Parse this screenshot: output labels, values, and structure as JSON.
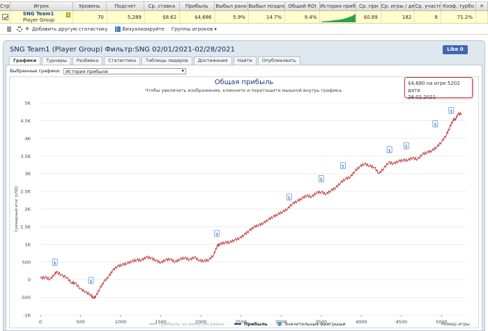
{
  "stats": {
    "headers": [
      "Стр.",
      "Игрок",
      "Уровень",
      "Подсчет",
      "Ср. ставка",
      "Прибыль",
      "Выбыл рано",
      "Выбыл поздно",
      "Общий ROI",
      "История прибыли",
      "Ср. при",
      "Ср. игры / день",
      "Ср. участни",
      "Коэф. турбо"
    ],
    "row": {
      "player_name": "SNG Team1",
      "player_group": "Player Group",
      "level": "70",
      "count": "5,289",
      "avg_stake": "$8.62",
      "profit": "$4,686",
      "early": "5.9%",
      "late": "14.7%",
      "roi": "9.4%",
      "avg_profit": "$0.89",
      "games_per_day": "182",
      "avg_participants": "9",
      "turbo": "71.2%"
    },
    "toolbar": {
      "add_stat": "Добавить другую статистику",
      "visualize": "Визуализируйте",
      "groups": "Группы игроков ▾"
    }
  },
  "panel": {
    "title": "SNG Team1 (Player Group) Фильтр:SNG 02/01/2021-02/28/2021",
    "like": "Like 0",
    "tabs": [
      "Графики",
      "Турниры",
      "Разбивка",
      "Статистика",
      "Таблицы лидеров",
      "Достижения",
      "Найти",
      "Опубликовать"
    ],
    "active_tab": 0,
    "select_label": "Выбранные графики:",
    "select_value": "История прибыли"
  },
  "tooltip": {
    "line1": "$4,680 на игре 5202 дата",
    "line2": "28.02.2021"
  },
  "legend": {
    "item1": "Прибыль за минусом рейка",
    "item2": "Прибыль",
    "item3": "Значительные выигрыши"
  },
  "colors": {
    "profit_line": "#c0393b",
    "rake_line": "#c8c8c8",
    "bigwin_marker": "#5b93d6",
    "sparkline": "#2e9e4f"
  },
  "chart_data": {
    "type": "line",
    "title": "Общая прибыль",
    "subtitle": "Чтобы увеличить изображение, кликните и перетащите мышкой внутрь графика.",
    "ylabel": "Суммарный итог (USD)",
    "xlabel": "Номер игры",
    "xlim": [
      0,
      5300
    ],
    "ylim": [
      -1000,
      5000
    ],
    "x_ticks": [
      "0",
      "500",
      "1000",
      "1500",
      "2000",
      "2500",
      "3000",
      "3500",
      "4000",
      "4500",
      "5000"
    ],
    "y_ticks": [
      "-1K",
      "-500",
      "0",
      "500",
      "1K",
      "1.5K",
      "2K",
      "2.5K",
      "3K",
      "3.5K",
      "4K",
      "4.5K",
      "5K"
    ],
    "grid": true,
    "legend_position": "bottom",
    "series": [
      {
        "name": "Прибыль",
        "x": [
          0,
          60,
          120,
          180,
          200,
          260,
          330,
          390,
          430,
          500,
          560,
          620,
          660,
          690,
          740,
          790,
          850,
          900,
          960,
          1020,
          1080,
          1140,
          1200,
          1260,
          1320,
          1380,
          1440,
          1500,
          1560,
          1620,
          1680,
          1740,
          1800,
          1860,
          1920,
          1980,
          2040,
          2100,
          2160,
          2200,
          2240,
          2300,
          2360,
          2420,
          2480,
          2540,
          2600,
          2660,
          2720,
          2780,
          2840,
          2900,
          2960,
          3020,
          3080,
          3140,
          3200,
          3260,
          3320,
          3380,
          3440,
          3500,
          3560,
          3620,
          3680,
          3740,
          3800,
          3860,
          3920,
          3980,
          4040,
          4100,
          4160,
          4220,
          4280,
          4340,
          4400,
          4460,
          4520,
          4580,
          4640,
          4700,
          4760,
          4820,
          4880,
          4940,
          5000,
          5060,
          5100,
          5140,
          5180,
          5202,
          5250
        ],
        "y": [
          40,
          70,
          10,
          160,
          220,
          130,
          60,
          -100,
          -90,
          -260,
          -350,
          -420,
          -520,
          -470,
          -250,
          -60,
          90,
          260,
          380,
          420,
          460,
          520,
          560,
          550,
          640,
          610,
          540,
          480,
          560,
          580,
          500,
          580,
          620,
          560,
          640,
          540,
          530,
          560,
          700,
          950,
          1010,
          1050,
          1060,
          1120,
          1170,
          1270,
          1380,
          1490,
          1540,
          1600,
          1700,
          1780,
          1850,
          1920,
          2000,
          2150,
          2220,
          2300,
          2380,
          2340,
          2460,
          2480,
          2420,
          2520,
          2600,
          2740,
          2850,
          2900,
          3070,
          3200,
          3280,
          3220,
          3180,
          3000,
          3150,
          3320,
          3280,
          3350,
          3380,
          3380,
          3450,
          3400,
          3550,
          3600,
          3650,
          3750,
          3900,
          4100,
          4300,
          4500,
          4560,
          4680,
          4700
        ]
      }
    ],
    "big_wins": [
      {
        "x": 180,
        "y": 290
      },
      {
        "x": 630,
        "y": -230
      },
      {
        "x": 2200,
        "y": 1100
      },
      {
        "x": 3100,
        "y": 2130
      },
      {
        "x": 3500,
        "y": 2650
      },
      {
        "x": 3770,
        "y": 3020
      },
      {
        "x": 4350,
        "y": 3470
      },
      {
        "x": 4560,
        "y": 3580
      },
      {
        "x": 4920,
        "y": 4200
      },
      {
        "x": 5120,
        "y": 4580
      }
    ]
  }
}
